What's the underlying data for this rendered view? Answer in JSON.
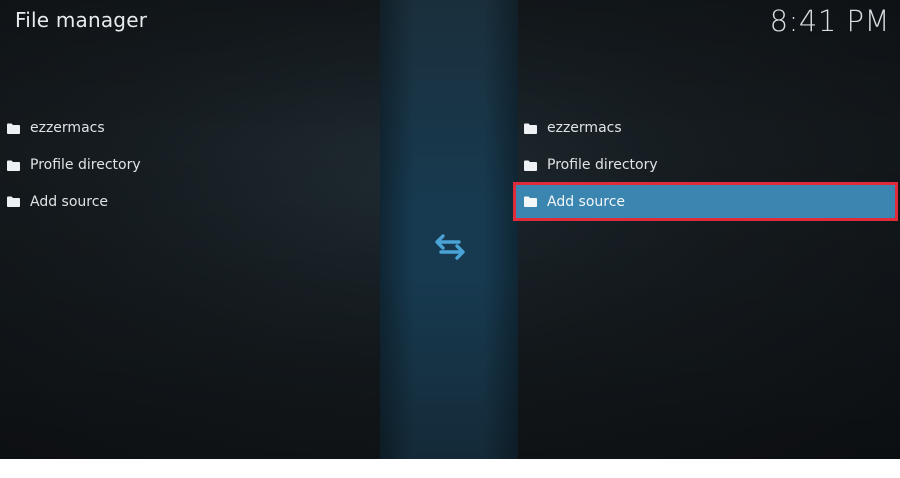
{
  "header": {
    "title": "File manager",
    "clock": "8:41 PM"
  },
  "left_pane": {
    "items": [
      {
        "label": "ezzermacs",
        "icon": "folder-icon"
      },
      {
        "label": "Profile directory",
        "icon": "folder-icon"
      },
      {
        "label": "Add source",
        "icon": "folder-icon"
      }
    ]
  },
  "right_pane": {
    "items": [
      {
        "label": "ezzermacs",
        "icon": "folder-icon"
      },
      {
        "label": "Profile directory",
        "icon": "folder-icon"
      },
      {
        "label": "Add source",
        "icon": "folder-icon",
        "focused": true
      }
    ]
  },
  "center": {
    "icon": "swap-arrows-icon"
  },
  "colors": {
    "highlight": "#3b86b0",
    "focus_outline": "#e02b3a",
    "accent_icon": "#4aa3d6"
  }
}
